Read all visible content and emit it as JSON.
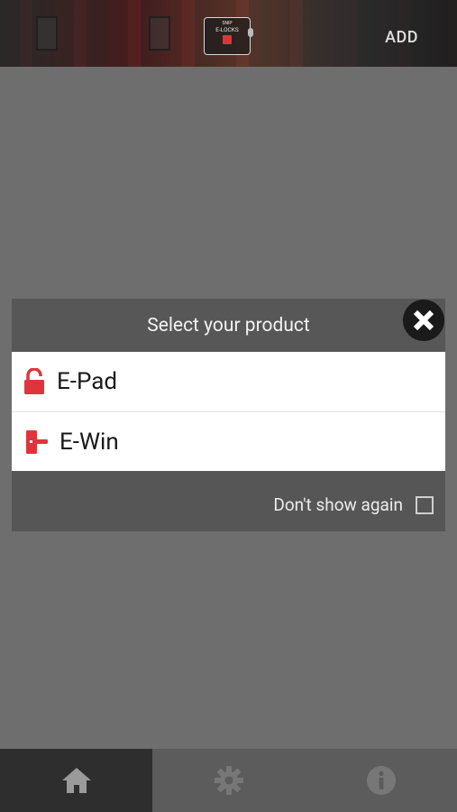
{
  "header": {
    "logo": {
      "line1": "SNIP",
      "line2": "E-LOCKS"
    },
    "add_label": "ADD"
  },
  "dialog": {
    "title": "Select your product",
    "products": [
      {
        "label": "E-Pad",
        "icon": "padlock-icon"
      },
      {
        "label": "E-Win",
        "icon": "window-handle-icon"
      }
    ],
    "dont_show_again_label": "Don't show again",
    "dont_show_again_checked": false
  },
  "bottom_nav": {
    "items": [
      {
        "name": "home",
        "icon": "home-icon",
        "active": true
      },
      {
        "name": "settings",
        "icon": "gear-icon",
        "active": false
      },
      {
        "name": "info",
        "icon": "info-icon",
        "active": false
      }
    ]
  },
  "colors": {
    "accent": "#e0343c",
    "overlay": "#6e6e6e",
    "dialog": "#575757"
  }
}
